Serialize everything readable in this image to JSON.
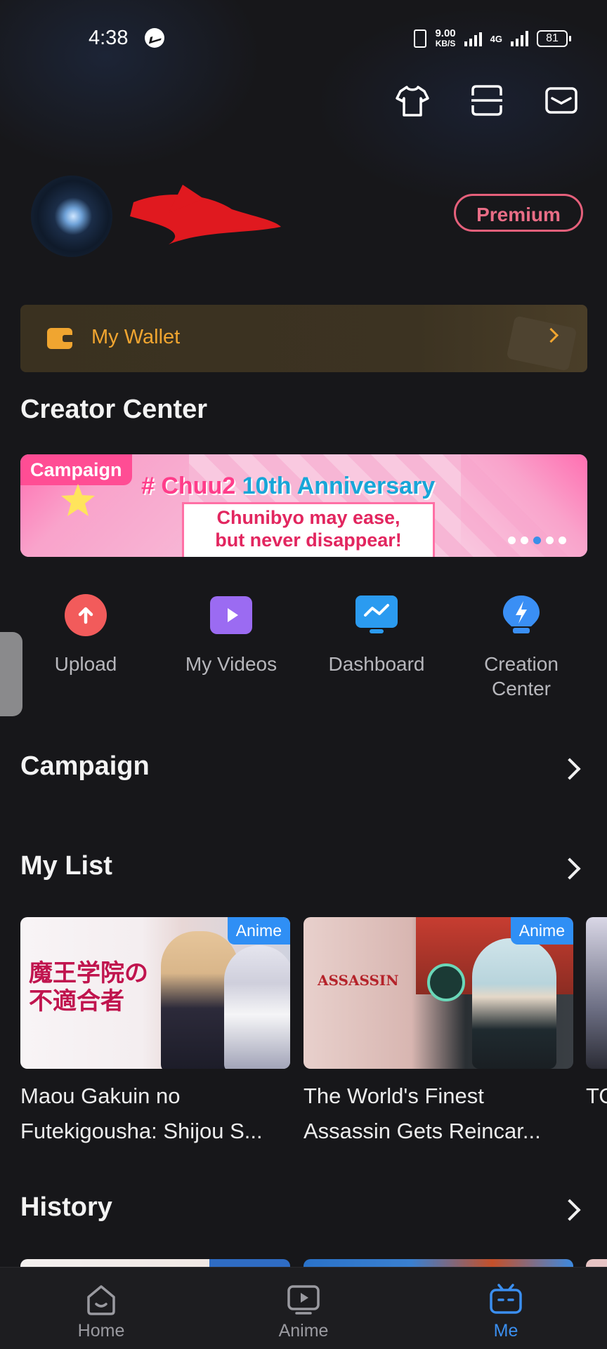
{
  "status_bar": {
    "time": "4:38",
    "net_speed_value": "9.00",
    "net_speed_unit": "KB/S",
    "network_type": "4G",
    "battery": "81"
  },
  "profile": {
    "premium_label": "Premium"
  },
  "wallet": {
    "label": "My Wallet"
  },
  "creator_center": {
    "title": "Creator Center",
    "banner": {
      "tag": "Campaign",
      "headline_hash": "# Chuu2 ",
      "headline_rest": "10th Anniversary",
      "subline_1": "Chunibyo may ease,",
      "subline_2": "but never disappear!"
    },
    "tools": [
      {
        "label": "Upload",
        "icon": "upload-icon",
        "color": "#f25b5b"
      },
      {
        "label": "My Videos",
        "icon": "play-icon",
        "color": "#9b6bf2"
      },
      {
        "label": "Dashboard",
        "icon": "dashboard-icon",
        "color": "#2b9bf0"
      },
      {
        "label": "Creation Center",
        "icon": "lightbulb-icon",
        "color": "#3a8ff5"
      }
    ]
  },
  "campaign_section": {
    "title": "Campaign"
  },
  "my_list": {
    "title": "My List",
    "items": [
      {
        "badge": "Anime",
        "title_line1": "Maou Gakuin no",
        "title_line2": "Futekigousha: Shijou S...",
        "thumb_text": "魔王学院の不適合者"
      },
      {
        "badge": "Anime",
        "title_line1": "The World's Finest",
        "title_line2": "Assassin Gets Reincar...",
        "thumb_text": "ASSASSIN"
      },
      {
        "title_line1": "TO"
      }
    ]
  },
  "history": {
    "title": "History"
  },
  "tab_bar": {
    "tabs": [
      {
        "label": "Home",
        "icon": "home-icon",
        "active": false
      },
      {
        "label": "Anime",
        "icon": "tv-play-icon",
        "active": false
      },
      {
        "label": "Me",
        "icon": "tv-face-icon",
        "active": true
      }
    ],
    "active_color": "#3b8ff0"
  }
}
